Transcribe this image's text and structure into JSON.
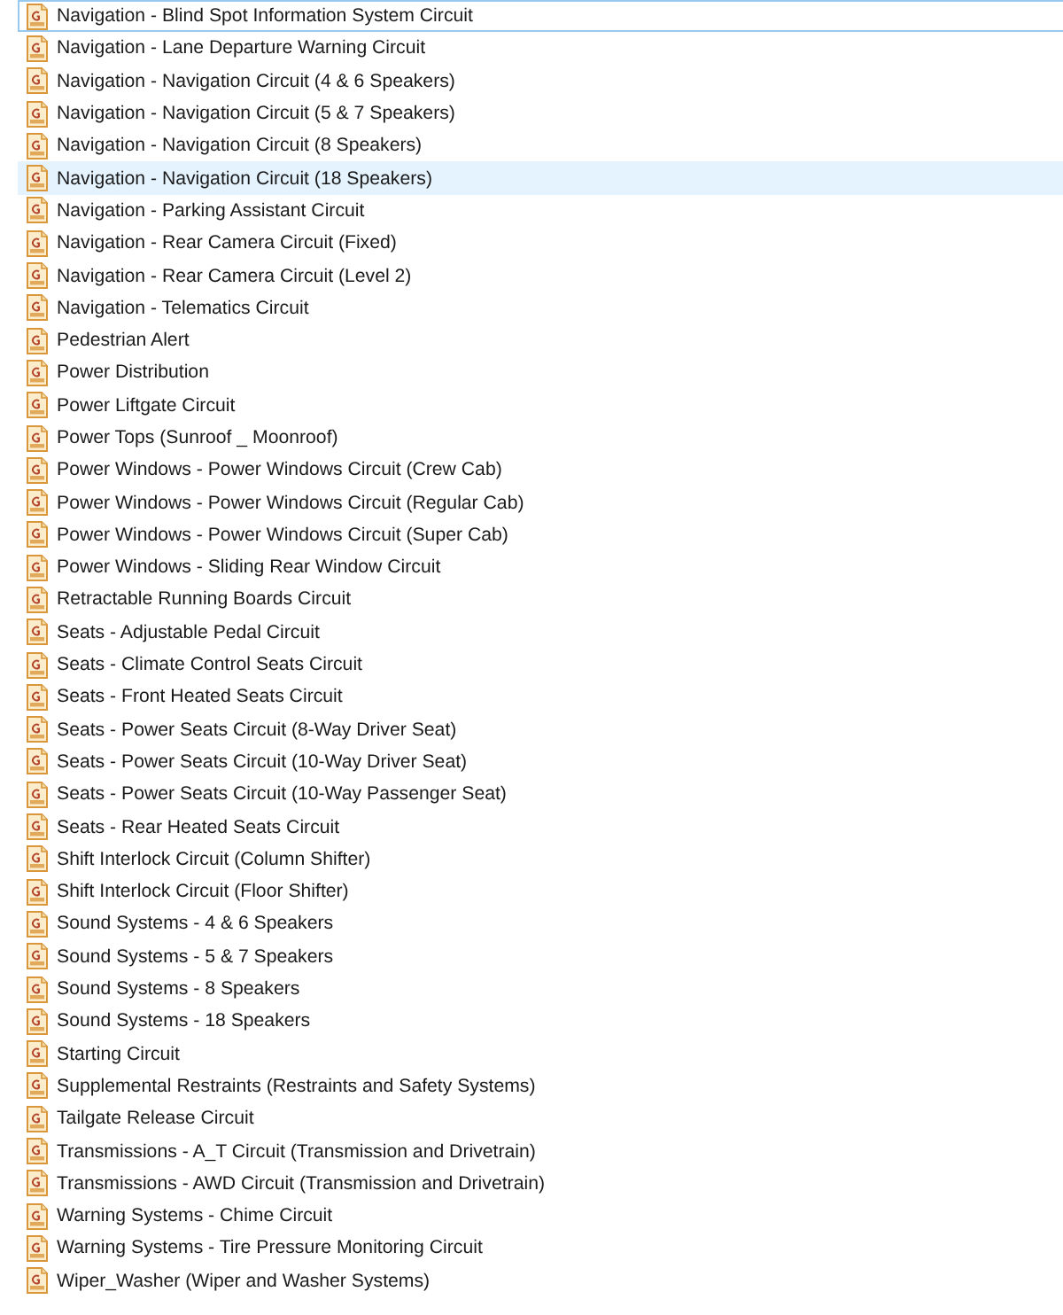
{
  "files": [
    {
      "name": "Navigation - Blind Spot Information System Circuit",
      "selected": false,
      "focused": true
    },
    {
      "name": "Navigation - Lane Departure Warning Circuit",
      "selected": false,
      "focused": false
    },
    {
      "name": "Navigation - Navigation Circuit (4 & 6 Speakers)",
      "selected": false,
      "focused": false
    },
    {
      "name": "Navigation - Navigation Circuit (5 & 7 Speakers)",
      "selected": false,
      "focused": false
    },
    {
      "name": "Navigation - Navigation Circuit (8 Speakers)",
      "selected": false,
      "focused": false
    },
    {
      "name": "Navigation - Navigation Circuit (18 Speakers)",
      "selected": true,
      "focused": false
    },
    {
      "name": "Navigation - Parking Assistant Circuit",
      "selected": false,
      "focused": false
    },
    {
      "name": "Navigation - Rear Camera Circuit (Fixed)",
      "selected": false,
      "focused": false
    },
    {
      "name": "Navigation - Rear Camera Circuit (Level 2)",
      "selected": false,
      "focused": false
    },
    {
      "name": "Navigation - Telematics Circuit",
      "selected": false,
      "focused": false
    },
    {
      "name": "Pedestrian Alert",
      "selected": false,
      "focused": false
    },
    {
      "name": "Power Distribution",
      "selected": false,
      "focused": false
    },
    {
      "name": "Power Liftgate Circuit",
      "selected": false,
      "focused": false
    },
    {
      "name": "Power Tops (Sunroof _ Moonroof)",
      "selected": false,
      "focused": false
    },
    {
      "name": "Power Windows - Power Windows Circuit (Crew Cab)",
      "selected": false,
      "focused": false
    },
    {
      "name": "Power Windows - Power Windows Circuit (Regular Cab)",
      "selected": false,
      "focused": false
    },
    {
      "name": "Power Windows - Power Windows Circuit (Super Cab)",
      "selected": false,
      "focused": false
    },
    {
      "name": "Power Windows - Sliding Rear Window Circuit",
      "selected": false,
      "focused": false
    },
    {
      "name": "Retractable Running Boards Circuit",
      "selected": false,
      "focused": false
    },
    {
      "name": "Seats - Adjustable Pedal Circuit",
      "selected": false,
      "focused": false
    },
    {
      "name": "Seats - Climate Control Seats Circuit",
      "selected": false,
      "focused": false
    },
    {
      "name": "Seats - Front Heated Seats Circuit",
      "selected": false,
      "focused": false
    },
    {
      "name": "Seats - Power Seats Circuit (8-Way Driver Seat)",
      "selected": false,
      "focused": false
    },
    {
      "name": "Seats - Power Seats Circuit (10-Way Driver Seat)",
      "selected": false,
      "focused": false
    },
    {
      "name": "Seats - Power Seats Circuit (10-Way Passenger Seat)",
      "selected": false,
      "focused": false
    },
    {
      "name": "Seats - Rear Heated Seats Circuit",
      "selected": false,
      "focused": false
    },
    {
      "name": "Shift Interlock Circuit (Column Shifter)",
      "selected": false,
      "focused": false
    },
    {
      "name": "Shift Interlock Circuit (Floor Shifter)",
      "selected": false,
      "focused": false
    },
    {
      "name": "Sound Systems - 4 & 6 Speakers",
      "selected": false,
      "focused": false
    },
    {
      "name": "Sound Systems - 5 & 7 Speakers",
      "selected": false,
      "focused": false
    },
    {
      "name": "Sound Systems - 8 Speakers",
      "selected": false,
      "focused": false
    },
    {
      "name": "Sound Systems - 18 Speakers",
      "selected": false,
      "focused": false
    },
    {
      "name": "Starting Circuit",
      "selected": false,
      "focused": false
    },
    {
      "name": "Supplemental Restraints (Restraints and Safety Systems)",
      "selected": false,
      "focused": false
    },
    {
      "name": "Tailgate Release Circuit",
      "selected": false,
      "focused": false
    },
    {
      "name": "Transmissions - A_T Circuit (Transmission and Drivetrain)",
      "selected": false,
      "focused": false
    },
    {
      "name": "Transmissions - AWD Circuit (Transmission and Drivetrain)",
      "selected": false,
      "focused": false
    },
    {
      "name": "Warning Systems - Chime Circuit",
      "selected": false,
      "focused": false
    },
    {
      "name": "Warning Systems - Tire Pressure Monitoring Circuit",
      "selected": false,
      "focused": false
    },
    {
      "name": "Wiper_Washer (Wiper and Washer Systems)",
      "selected": false,
      "focused": false
    }
  ]
}
